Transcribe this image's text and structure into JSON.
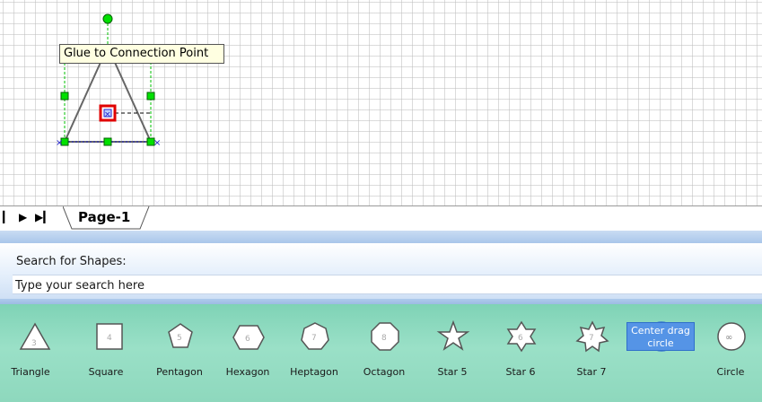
{
  "canvas": {
    "tooltip": "Glue to Connection Point"
  },
  "tabbar": {
    "nav_first": "⏮",
    "nav_prev": "◀",
    "nav_next": "▶",
    "nav_last": "⏭",
    "page_tab": "Page-1"
  },
  "shapes_panel": {
    "search_title": "Search for Shapes:",
    "search_placeholder": "Type your search here",
    "items": [
      {
        "label": "Triangle",
        "icon": "triangle-icon",
        "number": "3"
      },
      {
        "label": "Square",
        "icon": "square-icon",
        "number": "4"
      },
      {
        "label": "Pentagon",
        "icon": "pentagon-icon",
        "number": "5"
      },
      {
        "label": "Hexagon",
        "icon": "hexagon-icon",
        "number": "6"
      },
      {
        "label": "Heptagon",
        "icon": "heptagon-icon",
        "number": "7"
      },
      {
        "label": "Octagon",
        "icon": "octagon-icon",
        "number": "8"
      },
      {
        "label": "Star 5",
        "icon": "star5-icon",
        "number": ""
      },
      {
        "label": "Star 6",
        "icon": "star6-icon",
        "number": "6"
      },
      {
        "label": "Star 7",
        "icon": "star7-icon",
        "number": "7"
      },
      {
        "label": "Center drag circle",
        "icon": "center-drag-circle-icon",
        "number": ""
      },
      {
        "label": "Circle",
        "icon": "circle-icon",
        "number": "∞"
      }
    ]
  },
  "colors": {
    "handle_green": "#00e000",
    "selection_red": "#e00000",
    "stencil_green": "#8ed8bd",
    "selected_blue": "#5594e6"
  }
}
